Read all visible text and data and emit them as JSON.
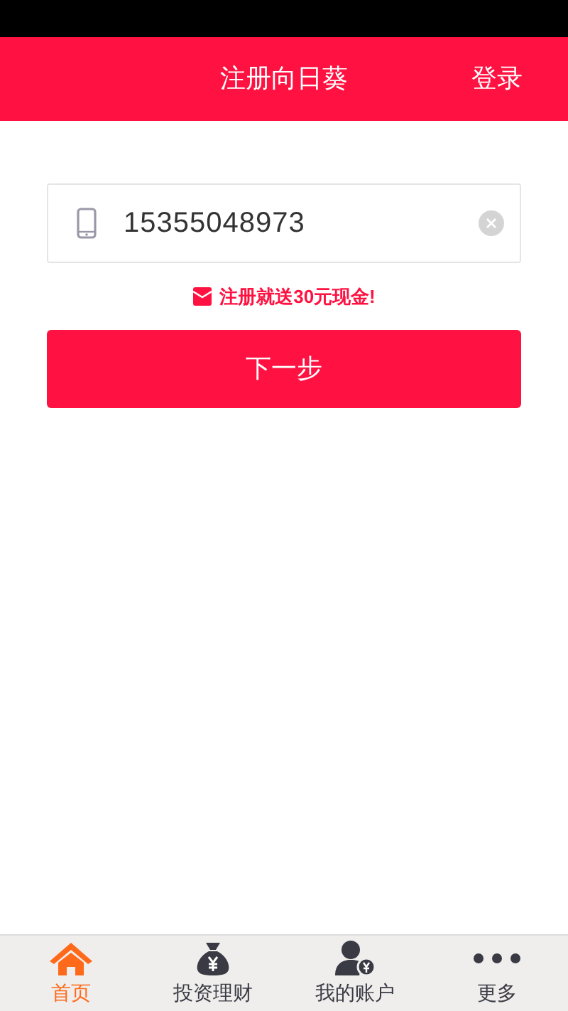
{
  "header": {
    "title": "注册向日葵",
    "action": "登录"
  },
  "phone_field": {
    "value": "15355048973"
  },
  "promo": "注册就送30元现金!",
  "next_button": "下一步",
  "tab_bar": [
    {
      "label": "首页",
      "kind": "home",
      "selected": true
    },
    {
      "label": "投资理财",
      "kind": "money",
      "selected": false
    },
    {
      "label": "我的账户",
      "kind": "account",
      "selected": false
    },
    {
      "label": "更多",
      "kind": "more",
      "selected": false
    }
  ]
}
